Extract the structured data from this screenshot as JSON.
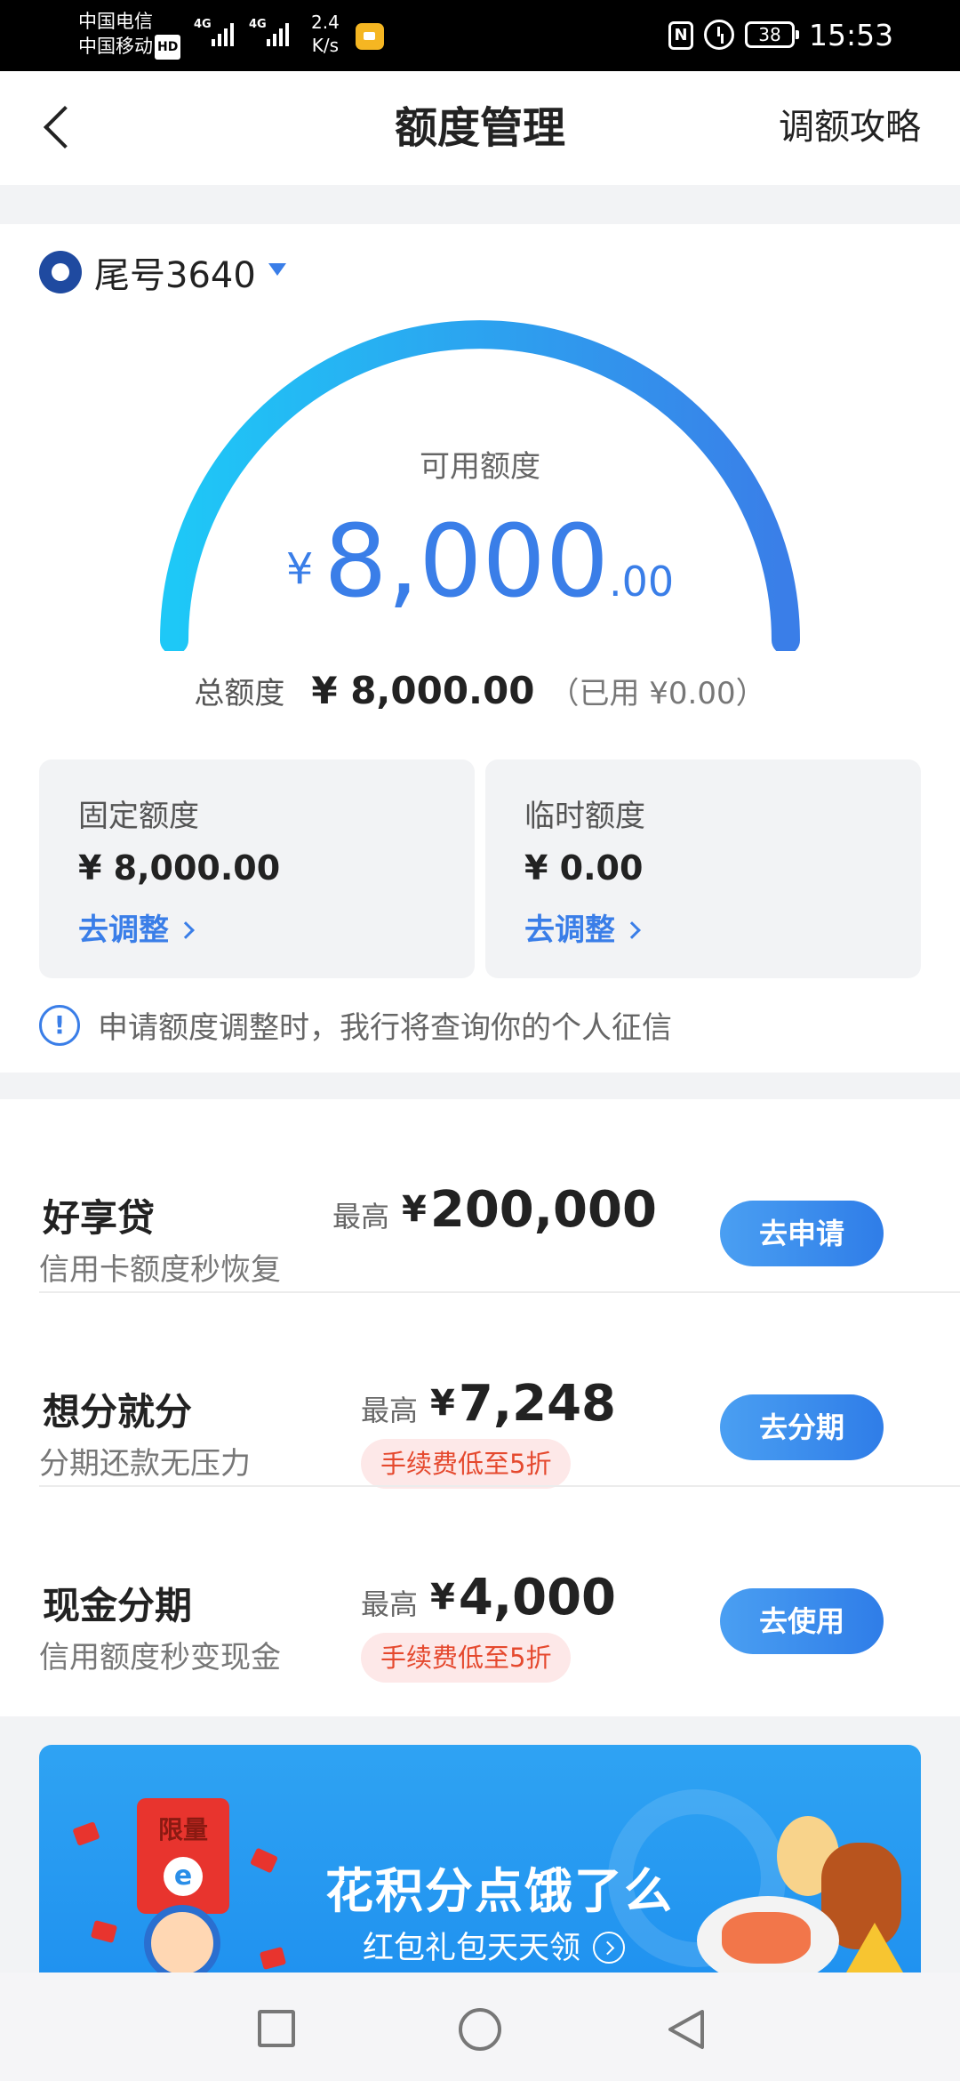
{
  "status_bar": {
    "carrier1": "中国电信",
    "carrier2": "中国移动",
    "hd": "HD",
    "network1": "4G",
    "network2": "4G",
    "speed_value": "2.4",
    "speed_unit": "K/s",
    "nfc": "N",
    "battery": "38",
    "time": "15:53"
  },
  "header": {
    "title": "额度管理",
    "right_link": "调额攻略"
  },
  "card": {
    "selector_label": "尾号3640",
    "available_label": "可用额度",
    "available_currency": "¥",
    "available_int": "8,000",
    "available_dec": ".00",
    "available_ratio": 1.0,
    "total_label": "总额度",
    "total_value": "¥ 8,000.00",
    "used_text": "（已用 ¥0.00）",
    "gauge_colors": [
      "#1ec8f7",
      "#3a7ee8"
    ],
    "fixed": {
      "title": "固定额度",
      "value": "¥ 8,000.00",
      "action": "去调整"
    },
    "temporary": {
      "title": "临时额度",
      "value": "¥ 0.00",
      "action": "去调整"
    },
    "notice": "申请额度调整时，我行将查询你的个人征信"
  },
  "products": [
    {
      "name": "好享贷",
      "subtitle": "信用卡额度秒恢复",
      "prefix": "最高",
      "currency": "¥",
      "amount": "200,000",
      "tag": "",
      "button": "去申请"
    },
    {
      "name": "想分就分",
      "subtitle": "分期还款无压力",
      "prefix": "最高",
      "currency": "¥",
      "amount": "7,248",
      "tag": "手续费低至5折",
      "button": "去分期"
    },
    {
      "name": "现金分期",
      "subtitle": "信用额度秒变现金",
      "prefix": "最高",
      "currency": "¥",
      "amount": "4,000",
      "tag": "手续费低至5折",
      "button": "去使用"
    }
  ],
  "banner": {
    "badge": "限量",
    "title": "花积分点饿了么",
    "subtitle": "红包礼包天天领"
  },
  "colors": {
    "accent": "#3a7ee8",
    "tag_text": "#e5492e",
    "tag_bg": "#fde8e8"
  }
}
